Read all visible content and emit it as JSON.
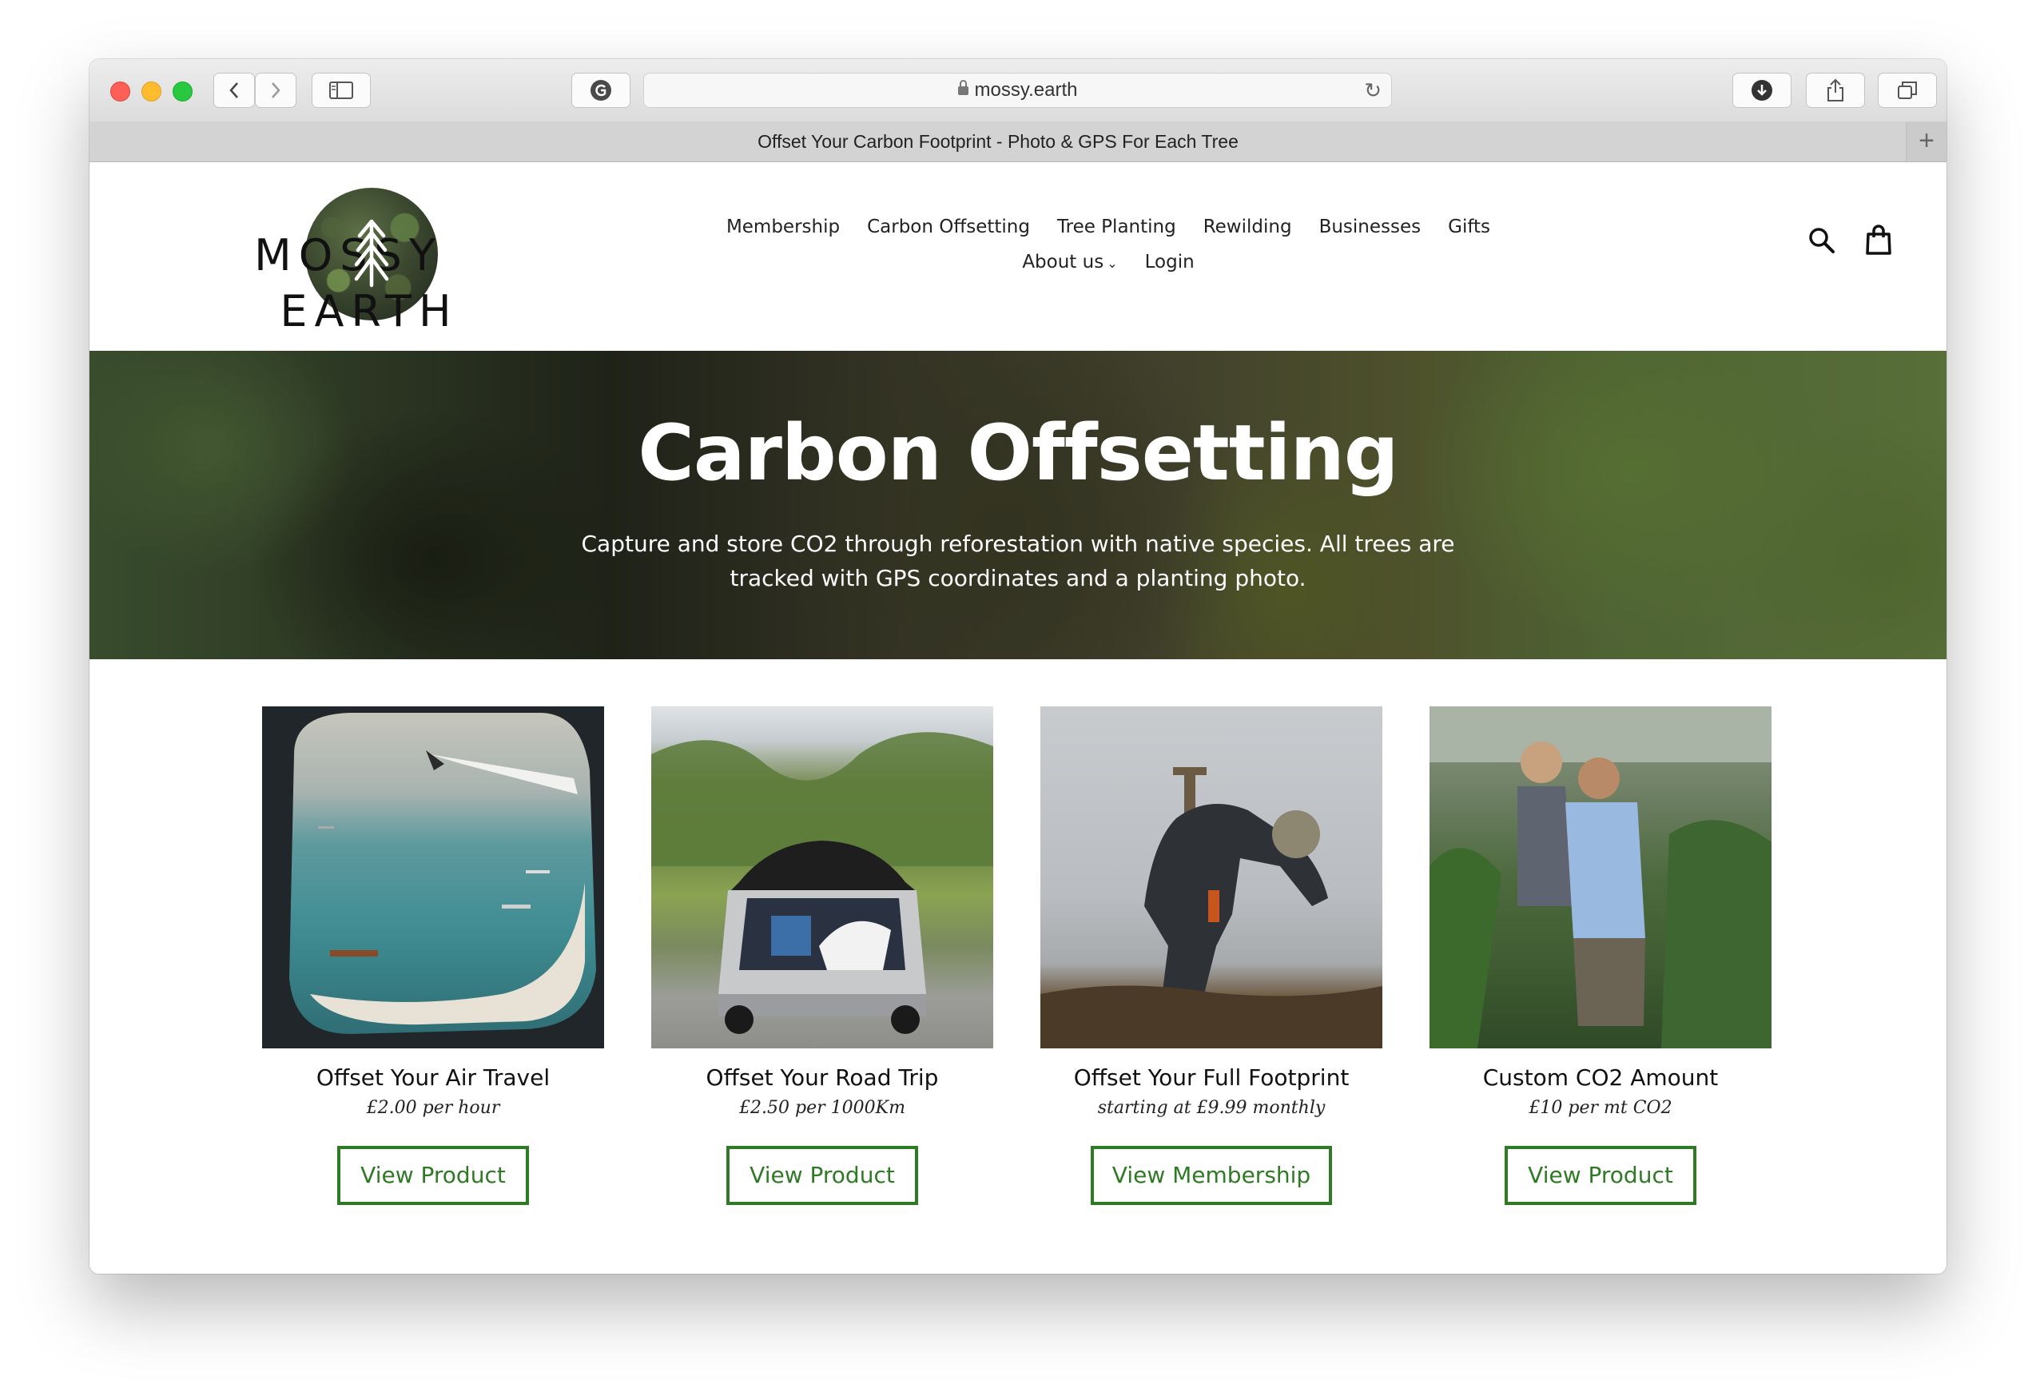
{
  "browser": {
    "url": "mossy.earth",
    "tab_title": "Offset Your Carbon Footprint - Photo & GPS For Each Tree"
  },
  "site": {
    "logo_text": "MOSSY EARTH",
    "logo_left": "MOSSY",
    "logo_right": "EARTH",
    "nav": {
      "row1": [
        "Membership",
        "Carbon Offsetting",
        "Tree Planting",
        "Rewilding",
        "Businesses",
        "Gifts"
      ],
      "row2": [
        "About us",
        "Login"
      ]
    },
    "hero": {
      "title": "Carbon Offsetting",
      "subtitle": "Capture and store CO2 through reforestation with native species. All trees are tracked with GPS coordinates and a planting photo."
    },
    "products": [
      {
        "name": "Offset Your Air Travel",
        "price": "£2.00 per hour",
        "button": "View Product"
      },
      {
        "name": "Offset Your Road Trip",
        "price": "£2.50 per 1000Km",
        "button": "View Product"
      },
      {
        "name": "Offset Your Full Footprint",
        "price": "starting at £9.99 monthly",
        "button": "View Membership"
      },
      {
        "name": "Custom CO2 Amount",
        "price": "£10 per mt CO2",
        "button": "View Product"
      }
    ]
  },
  "colors": {
    "accent_green": "#2f7a24"
  }
}
